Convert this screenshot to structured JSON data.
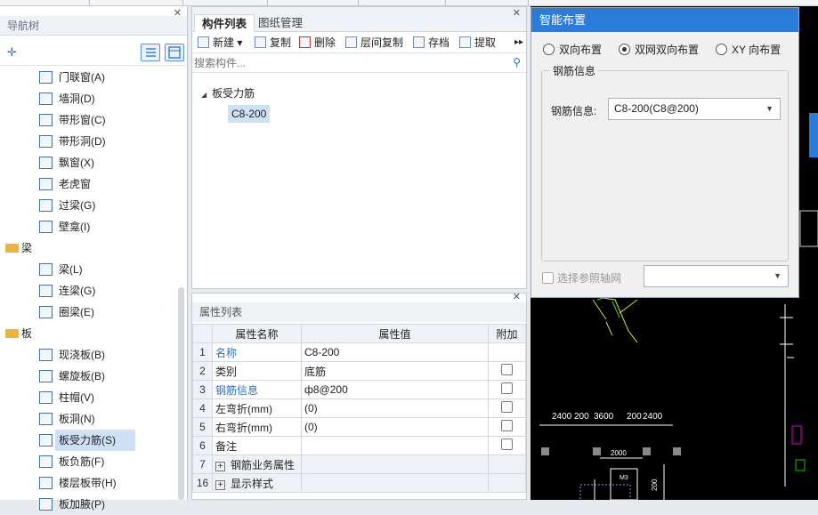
{
  "nav": {
    "title": "导航树",
    "items": [
      {
        "type": "child",
        "label": "门联窗(A)"
      },
      {
        "type": "child",
        "label": "墙洞(D)"
      },
      {
        "type": "child",
        "label": "带形窗(C)"
      },
      {
        "type": "child",
        "label": "带形洞(D)"
      },
      {
        "type": "child",
        "label": "飘窗(X)"
      },
      {
        "type": "child",
        "label": "老虎窗"
      },
      {
        "type": "child",
        "label": "过梁(G)"
      },
      {
        "type": "child",
        "label": "壁龛(I)"
      },
      {
        "type": "group",
        "label": "梁"
      },
      {
        "type": "child",
        "label": "梁(L)"
      },
      {
        "type": "child",
        "label": "连梁(G)"
      },
      {
        "type": "child",
        "label": "圈梁(E)"
      },
      {
        "type": "group",
        "label": "板"
      },
      {
        "type": "child",
        "label": "现浇板(B)"
      },
      {
        "type": "child",
        "label": "螺旋板(B)"
      },
      {
        "type": "child",
        "label": "柱帽(V)"
      },
      {
        "type": "child",
        "label": "板洞(N)"
      },
      {
        "type": "child",
        "label": "板受力筋(S)",
        "selected": true
      },
      {
        "type": "child",
        "label": "板负筋(F)"
      },
      {
        "type": "child",
        "label": "楼层板带(H)"
      },
      {
        "type": "child",
        "label": "板加腋(P)"
      }
    ]
  },
  "components": {
    "tabs": [
      "构件列表",
      "图纸管理"
    ],
    "toolbar": [
      "新建",
      "复制",
      "删除",
      "层间复制",
      "存档",
      "提取"
    ],
    "search_placeholder": "搜索构件...",
    "tree_root": "板受力筋",
    "tree_child": "C8-200"
  },
  "props": {
    "title": "属性列表",
    "headers": [
      "属性名称",
      "属性值",
      "附加"
    ],
    "rows": [
      {
        "num": "1",
        "name": "名称",
        "value": "C8-200",
        "blue": true,
        "check": false
      },
      {
        "num": "2",
        "name": "类别",
        "value": "底筋",
        "blue": false,
        "check": true
      },
      {
        "num": "3",
        "name": "钢筋信息",
        "value": "ф8@200",
        "blue": true,
        "check": true
      },
      {
        "num": "4",
        "name": "左弯折(mm)",
        "value": "(0)",
        "blue": false,
        "check": true
      },
      {
        "num": "5",
        "name": "右弯折(mm)",
        "value": "(0)",
        "blue": false,
        "check": true
      },
      {
        "num": "6",
        "name": "备注",
        "value": "",
        "blue": false,
        "check": true
      },
      {
        "num": "7",
        "name": "钢筋业务属性",
        "value": "",
        "blue": false,
        "check": false,
        "expand": true
      },
      {
        "num": "16",
        "name": "显示样式",
        "value": "",
        "blue": false,
        "check": false,
        "expand": true
      }
    ]
  },
  "dialog": {
    "title": "智能布置",
    "radios": [
      "双向布置",
      "双网双向布置",
      "XY 向布置"
    ],
    "selected_radio": 1,
    "group_title": "钢筋信息",
    "field_label": "钢筋信息:",
    "field_value": "C8-200(C8@200)",
    "axis_checkbox": "选择参照轴网",
    "axis_select_value": ""
  },
  "drawing": {
    "dims": [
      "2400",
      "200",
      "3600",
      "200",
      "2400",
      "2000",
      "M3",
      "200"
    ]
  },
  "colors": {
    "accent": "#2b7bd9",
    "selection": "#cfe0f5",
    "cad_bg": "#000000"
  }
}
